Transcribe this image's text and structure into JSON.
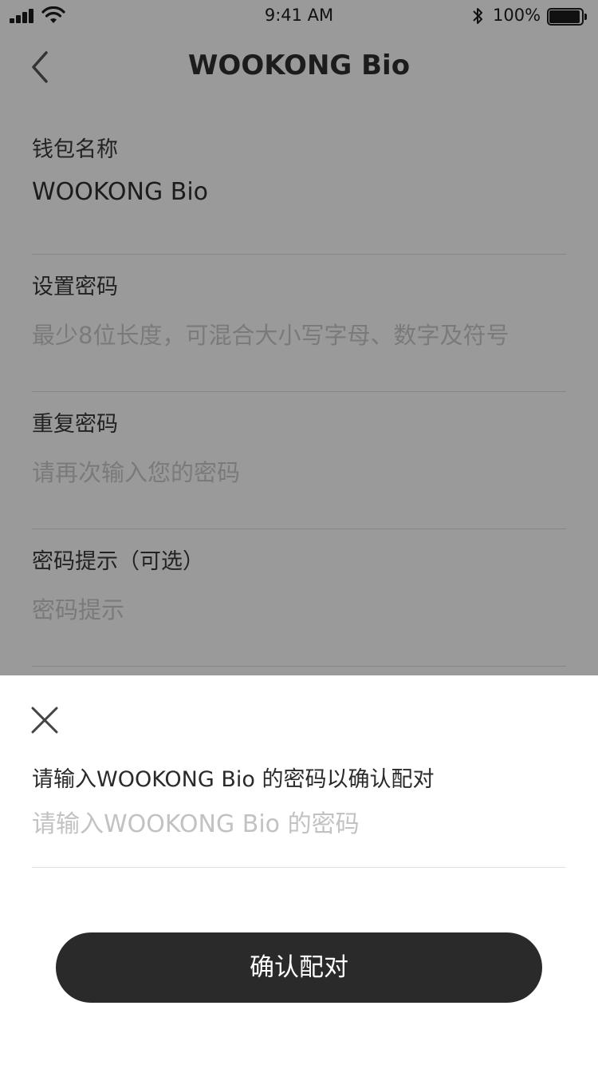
{
  "status_bar": {
    "time": "9:41 AM",
    "battery": "100%",
    "icons": [
      "signal-icon",
      "wifi-icon",
      "bluetooth-icon",
      "battery-icon"
    ]
  },
  "nav": {
    "title": "WOOKONG Bio",
    "back_icon": "chevron-left-icon"
  },
  "form": {
    "wallet_name": {
      "label": "钱包名称",
      "value": "WOOKONG Bio"
    },
    "set_password": {
      "label": "设置密码",
      "placeholder": "最少8位长度，可混合大小写字母、数字及符号"
    },
    "repeat_password": {
      "label": "重复密码",
      "placeholder": "请再次输入您的密码"
    },
    "password_hint": {
      "label": "密码提示（可选）",
      "placeholder": "密码提示"
    }
  },
  "sheet": {
    "close_icon": "close-icon",
    "prompt": "请输入WOOKONG Bio 的密码以确认配对",
    "input_placeholder": "请输入WOOKONG Bio 的密码",
    "confirm_label": "确认配对"
  },
  "colors": {
    "overlay_bg": "#9a9a9a",
    "sheet_bg": "#ffffff",
    "button_bg": "#2a2a2a",
    "button_text": "#ffffff",
    "placeholder": "#c2c2c2"
  }
}
